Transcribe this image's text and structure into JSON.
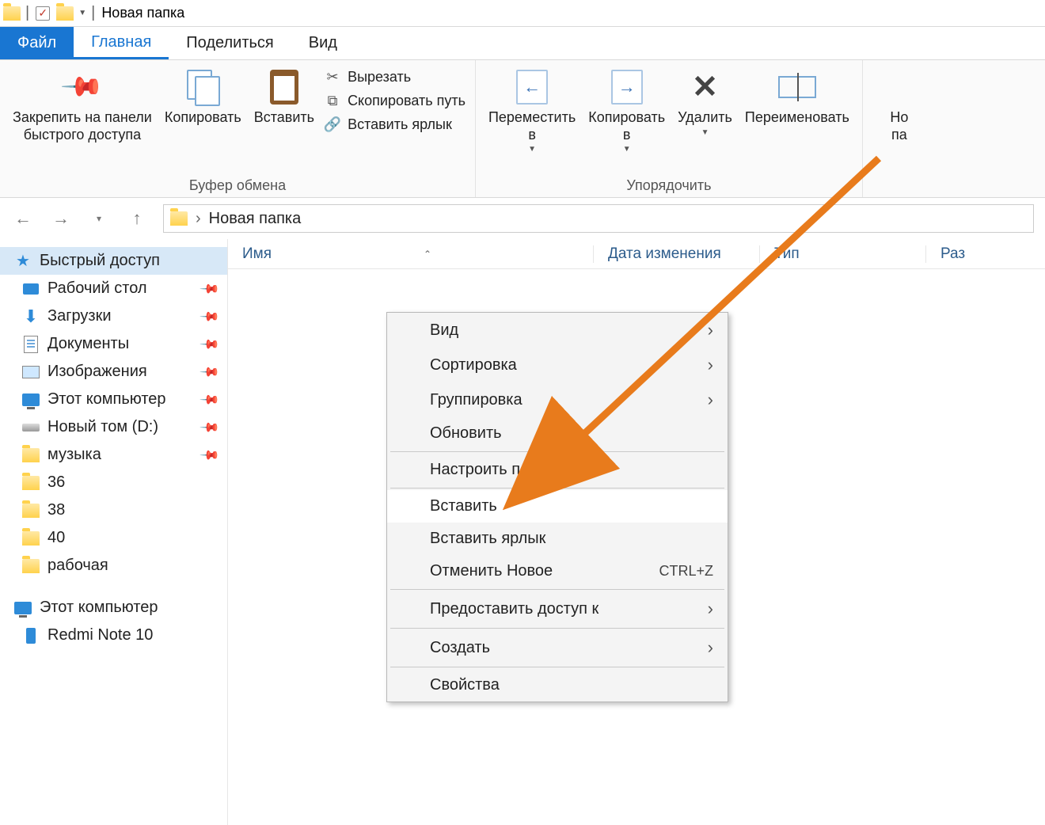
{
  "title": "Новая папка",
  "tabs": {
    "file": "Файл",
    "home": "Главная",
    "share": "Поделиться",
    "view": "Вид"
  },
  "ribbon": {
    "clipboard": {
      "pin": "Закрепить на панели\nбыстрого доступа",
      "copy": "Копировать",
      "paste": "Вставить",
      "cut": "Вырезать",
      "copy_path": "Скопировать путь",
      "paste_shortcut": "Вставить ярлык",
      "label": "Буфер обмена"
    },
    "organize": {
      "move_to": "Переместить\nв",
      "copy_to": "Копировать\nв",
      "delete": "Удалить",
      "rename": "Переименовать",
      "label": "Упорядочить"
    },
    "new": {
      "folder": "Но\nпа"
    }
  },
  "breadcrumb": "Новая папка",
  "columns": {
    "name": "Имя",
    "date": "Дата изменения",
    "type": "Тип",
    "size": "Раз"
  },
  "sidebar": {
    "quick": "Быстрый доступ",
    "items": [
      "Рабочий стол",
      "Загрузки",
      "Документы",
      "Изображения",
      "Этот компьютер",
      "Новый том (D:)",
      "музыка",
      "36",
      "38",
      "40",
      "рабочая"
    ],
    "this_pc": "Этот компьютер",
    "phone": "Redmi Note 10"
  },
  "context_menu": {
    "view": "Вид",
    "sort": "Сортировка",
    "group": "Группировка",
    "refresh": "Обновить",
    "customize": "Настроить папку…",
    "paste": "Вставить",
    "paste_shortcut": "Вставить ярлык",
    "undo": "Отменить Новое",
    "undo_key": "CTRL+Z",
    "share": "Предоставить доступ к",
    "new": "Создать",
    "properties": "Свойства"
  }
}
